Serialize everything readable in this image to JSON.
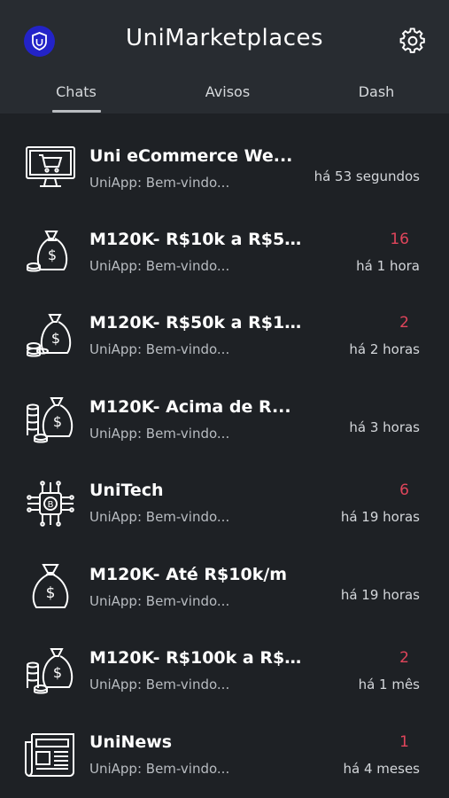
{
  "header": {
    "title": "UniMarketplaces",
    "logo_icon": "shield-logo-icon",
    "settings_icon": "gear-icon"
  },
  "tabs": [
    {
      "label": "Chats",
      "active": true
    },
    {
      "label": "Avisos",
      "active": false
    },
    {
      "label": "Dash",
      "active": false
    }
  ],
  "colors": {
    "background": "#1e2125",
    "header": "#282c31",
    "logo": "#2323c8",
    "badge": "#e0455b"
  },
  "chats": [
    {
      "name": "Uni eCommerce We...",
      "preview": "UniApp: Bem-vindo...",
      "time": "há 53 segundos",
      "badge": "",
      "icon": "monitor-cart-icon"
    },
    {
      "name": "M120K- R$10k a R$5...",
      "preview": "UniApp: Bem-vindo...",
      "time": "há 1 hora",
      "badge": "16",
      "icon": "money-bag-coin-icon"
    },
    {
      "name": "M120K- R$50k a R$1...",
      "preview": "UniApp: Bem-vindo...",
      "time": "há 2 horas",
      "badge": "2",
      "icon": "money-bag-coins-icon"
    },
    {
      "name": "M120K- Acima de R...",
      "preview": "UniApp: Bem-vindo...",
      "time": "há 3 horas",
      "badge": "",
      "icon": "money-bag-stacks-icon"
    },
    {
      "name": "UniTech",
      "preview": "UniApp: Bem-vindo...",
      "time": "há 19 horas",
      "badge": "6",
      "icon": "chip-bitcoin-icon"
    },
    {
      "name": "M120K- Até R$10k/m",
      "preview": "UniApp: Bem-vindo...",
      "time": "há 19 horas",
      "badge": "",
      "icon": "money-bag-icon"
    },
    {
      "name": "M120K- R$100k a R$...",
      "preview": "UniApp: Bem-vindo...",
      "time": "há 1 mês",
      "badge": "2",
      "icon": "money-bag-stack-icon"
    },
    {
      "name": "UniNews",
      "preview": "UniApp: Bem-vindo...",
      "time": "há 4 meses",
      "badge": "1",
      "icon": "newspaper-icon"
    }
  ]
}
